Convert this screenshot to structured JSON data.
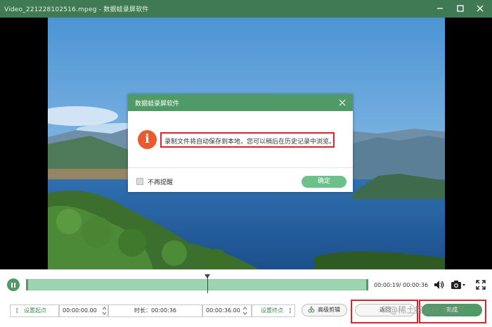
{
  "window": {
    "title": "Video_221228102516.mpeg  -  数据蛙录屏软件"
  },
  "dialog": {
    "title": "数据蛙录屏软件",
    "message": "录制文件将自动保存到本地，您可以稍后在历史记录中浏览。",
    "info_glyph": "i",
    "checkbox_label": "不再提醒",
    "confirm_label": "确定"
  },
  "player": {
    "time_readout": "00:00:19/ 00:00:36",
    "progress_fraction": 0.53
  },
  "editor": {
    "set_start_label": "设置起点",
    "start_value": "00:00:00.00",
    "duration_label": "时长：00:00:36",
    "end_value": "00:00:36.00",
    "set_end_label": "设置终点",
    "advanced_label": "高级剪辑",
    "back_label": "返回",
    "done_label": "完成"
  },
  "watermark": "@稀土掘金技术社区",
  "icons": {
    "minimize": "minimize-icon",
    "maximize": "maximize-icon",
    "close": "close-icon",
    "pause": "pause-icon",
    "volume": "volume-icon",
    "camera": "camera-icon",
    "fullscreen": "fullscreen-icon",
    "scissors": "scissors-icon"
  },
  "colors": {
    "titlebar": "#3f7a55",
    "accent": "#4f9a66",
    "confirm": "#6cc08a",
    "highlight": "#d9232d",
    "info": "#e95a2f"
  }
}
